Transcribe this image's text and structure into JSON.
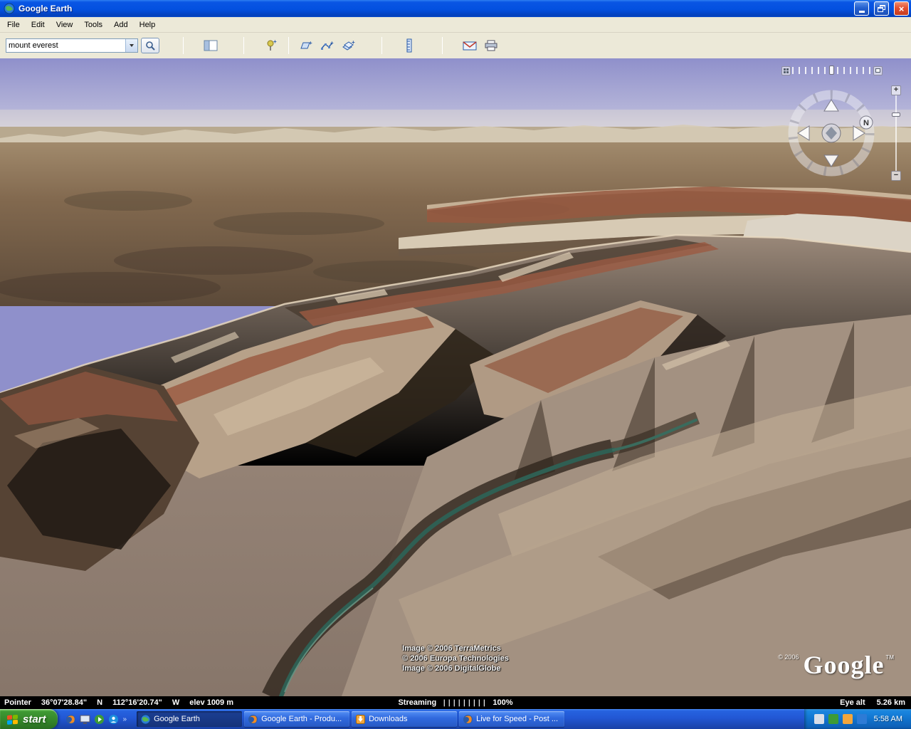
{
  "window": {
    "title": "Google Earth"
  },
  "menu": {
    "items": [
      "File",
      "Edit",
      "View",
      "Tools",
      "Add",
      "Help"
    ]
  },
  "toolbar": {
    "search_value": "mount everest"
  },
  "view": {
    "attribution_lines": [
      "Image © 2006 TerraMetrics",
      "© 2006 Europa Technologies",
      "Image © 2006 DigitalGlobe"
    ],
    "logo_copyright": "© 2006",
    "logo_text": "Google",
    "logo_tm": "TM",
    "compass_n": "N",
    "zoom_plus": "+",
    "zoom_minus": "−"
  },
  "statusbar": {
    "pointer_label": "Pointer",
    "latitude": "36°07'28.84\"",
    "lat_hemisphere": "N",
    "longitude": "112°16'20.74\"",
    "lon_hemisphere": "W",
    "elevation": "elev 1009 m",
    "streaming_label": "Streaming",
    "streaming_bars": "|||||||||",
    "streaming_percent": "100%",
    "eye_alt_label": "Eye alt",
    "eye_alt_value": "5.26 km"
  },
  "taskbar": {
    "start_label": "start",
    "tasks": [
      {
        "label": "Google Earth"
      },
      {
        "label": "Google Earth - Produ..."
      },
      {
        "label": "Downloads"
      },
      {
        "label": "Live for Speed - Post ..."
      }
    ],
    "clock": "5:58 AM"
  }
}
